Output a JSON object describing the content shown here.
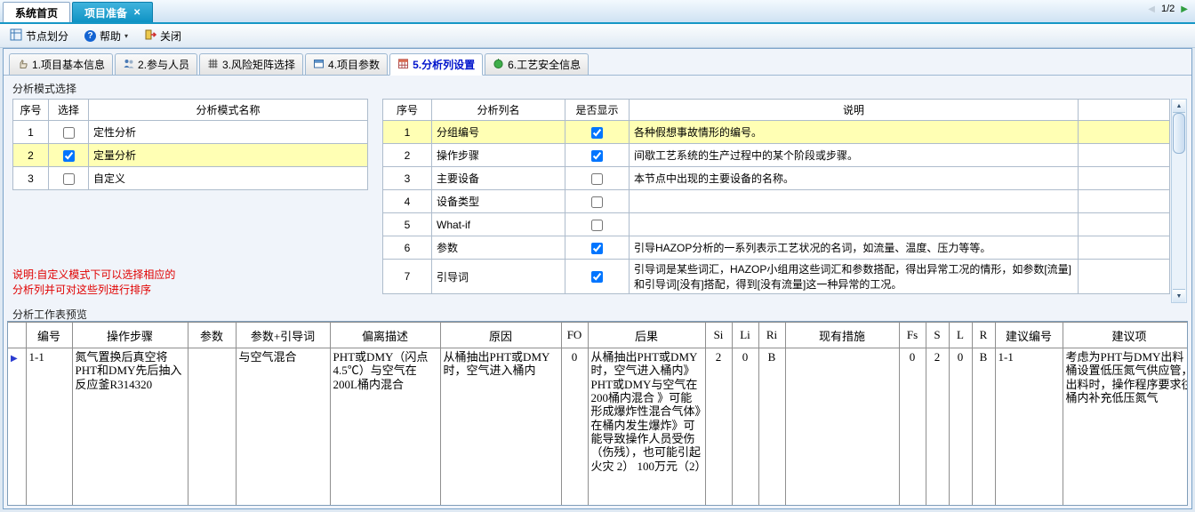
{
  "icons": {
    "tab_close": "✕",
    "pager_prev": "◀",
    "pager_next": "▶",
    "help_q": "?",
    "dropdown": "▾",
    "scroll_up": "▲",
    "scroll_down": "▼",
    "row_marker": "▶"
  },
  "window_tabs": {
    "items": [
      {
        "label": "系统首页"
      },
      {
        "label": "项目准备"
      }
    ],
    "pager": "1/2"
  },
  "toolbar": {
    "node_divide": "节点划分",
    "help": "帮助",
    "close": "关闭"
  },
  "nav_tabs": [
    {
      "label": "1.项目基本信息"
    },
    {
      "label": "2.参与人员"
    },
    {
      "label": "3.风险矩阵选择"
    },
    {
      "label": "4.项目参数"
    },
    {
      "label": "5.分析列设置"
    },
    {
      "label": "6.工艺安全信息"
    }
  ],
  "mode_section": {
    "title": "分析模式选择",
    "table": {
      "headers": [
        "序号",
        "选择",
        "分析模式名称"
      ],
      "rows": [
        {
          "no": "1",
          "selected": false,
          "name": "定性分析",
          "highlight": false
        },
        {
          "no": "2",
          "selected": true,
          "name": "定量分析",
          "highlight": true
        },
        {
          "no": "3",
          "selected": false,
          "name": "自定义",
          "highlight": false
        }
      ]
    },
    "note_lines": [
      "说明:自定义模式下可以选择相应的",
      "分析列并可对这些列进行排序"
    ]
  },
  "columns_table": {
    "headers": [
      "序号",
      "分析列名",
      "是否显示",
      "说明"
    ],
    "rows": [
      {
        "no": "1",
        "name": "分组编号",
        "show": true,
        "desc": "各种假想事故情形的编号。",
        "highlight": true
      },
      {
        "no": "2",
        "name": "操作步骤",
        "show": true,
        "desc": "间歇工艺系统的生产过程中的某个阶段或步骤。",
        "highlight": false
      },
      {
        "no": "3",
        "name": "主要设备",
        "show": false,
        "desc": "本节点中出现的主要设备的名称。",
        "highlight": false
      },
      {
        "no": "4",
        "name": "设备类型",
        "show": false,
        "desc": "",
        "highlight": false
      },
      {
        "no": "5",
        "name": "What-if",
        "show": false,
        "desc": "",
        "highlight": false
      },
      {
        "no": "6",
        "name": "参数",
        "show": true,
        "desc": "引导HAZOP分析的一系列表示工艺状况的名词，如流量、温度、压力等等。",
        "highlight": false
      },
      {
        "no": "7",
        "name": "引导词",
        "show": true,
        "desc": "引导词是某些词汇，HAZOP小组用这些词汇和参数搭配，得出异常工况的情形，如参数[流量]和引导词[没有]搭配，得到[没有流量]这一种异常的工况。",
        "highlight": false
      }
    ]
  },
  "preview": {
    "title": "分析工作表预览",
    "headers": [
      "编号",
      "操作步骤",
      "参数",
      "参数+引导词",
      "偏离描述",
      "原因",
      "FO",
      "后果",
      "Si",
      "Li",
      "Ri",
      "现有措施",
      "Fs",
      "S",
      "L",
      "R",
      "建议编号",
      "建议项"
    ],
    "rows": [
      [
        "1-1",
        "氮气置换后真空将PHT和DMY先后抽入反应釜R314320",
        "",
        "与空气混合",
        "PHT或DMY（闪点4.5℃）与空气在200L桶内混合",
        "从桶抽出PHT或DMY时，空气进入桶内",
        "0",
        "从桶抽出PHT或DMY时，空气进入桶内》PHT或DMY与空气在200桶内混合 》可能形成爆炸性混合气体》在桶内发生爆炸》可能导致操作人员受伤（伤残），也可能引起火灾 2） 100万元（2）",
        "2",
        "0",
        "B",
        "",
        "0",
        "2",
        "0",
        "B",
        "1-1",
        "考虑为PHT与DMY出料桶设置低压氮气供应管，出料时，操作程序要求往桶内补充低压氮气"
      ]
    ]
  }
}
